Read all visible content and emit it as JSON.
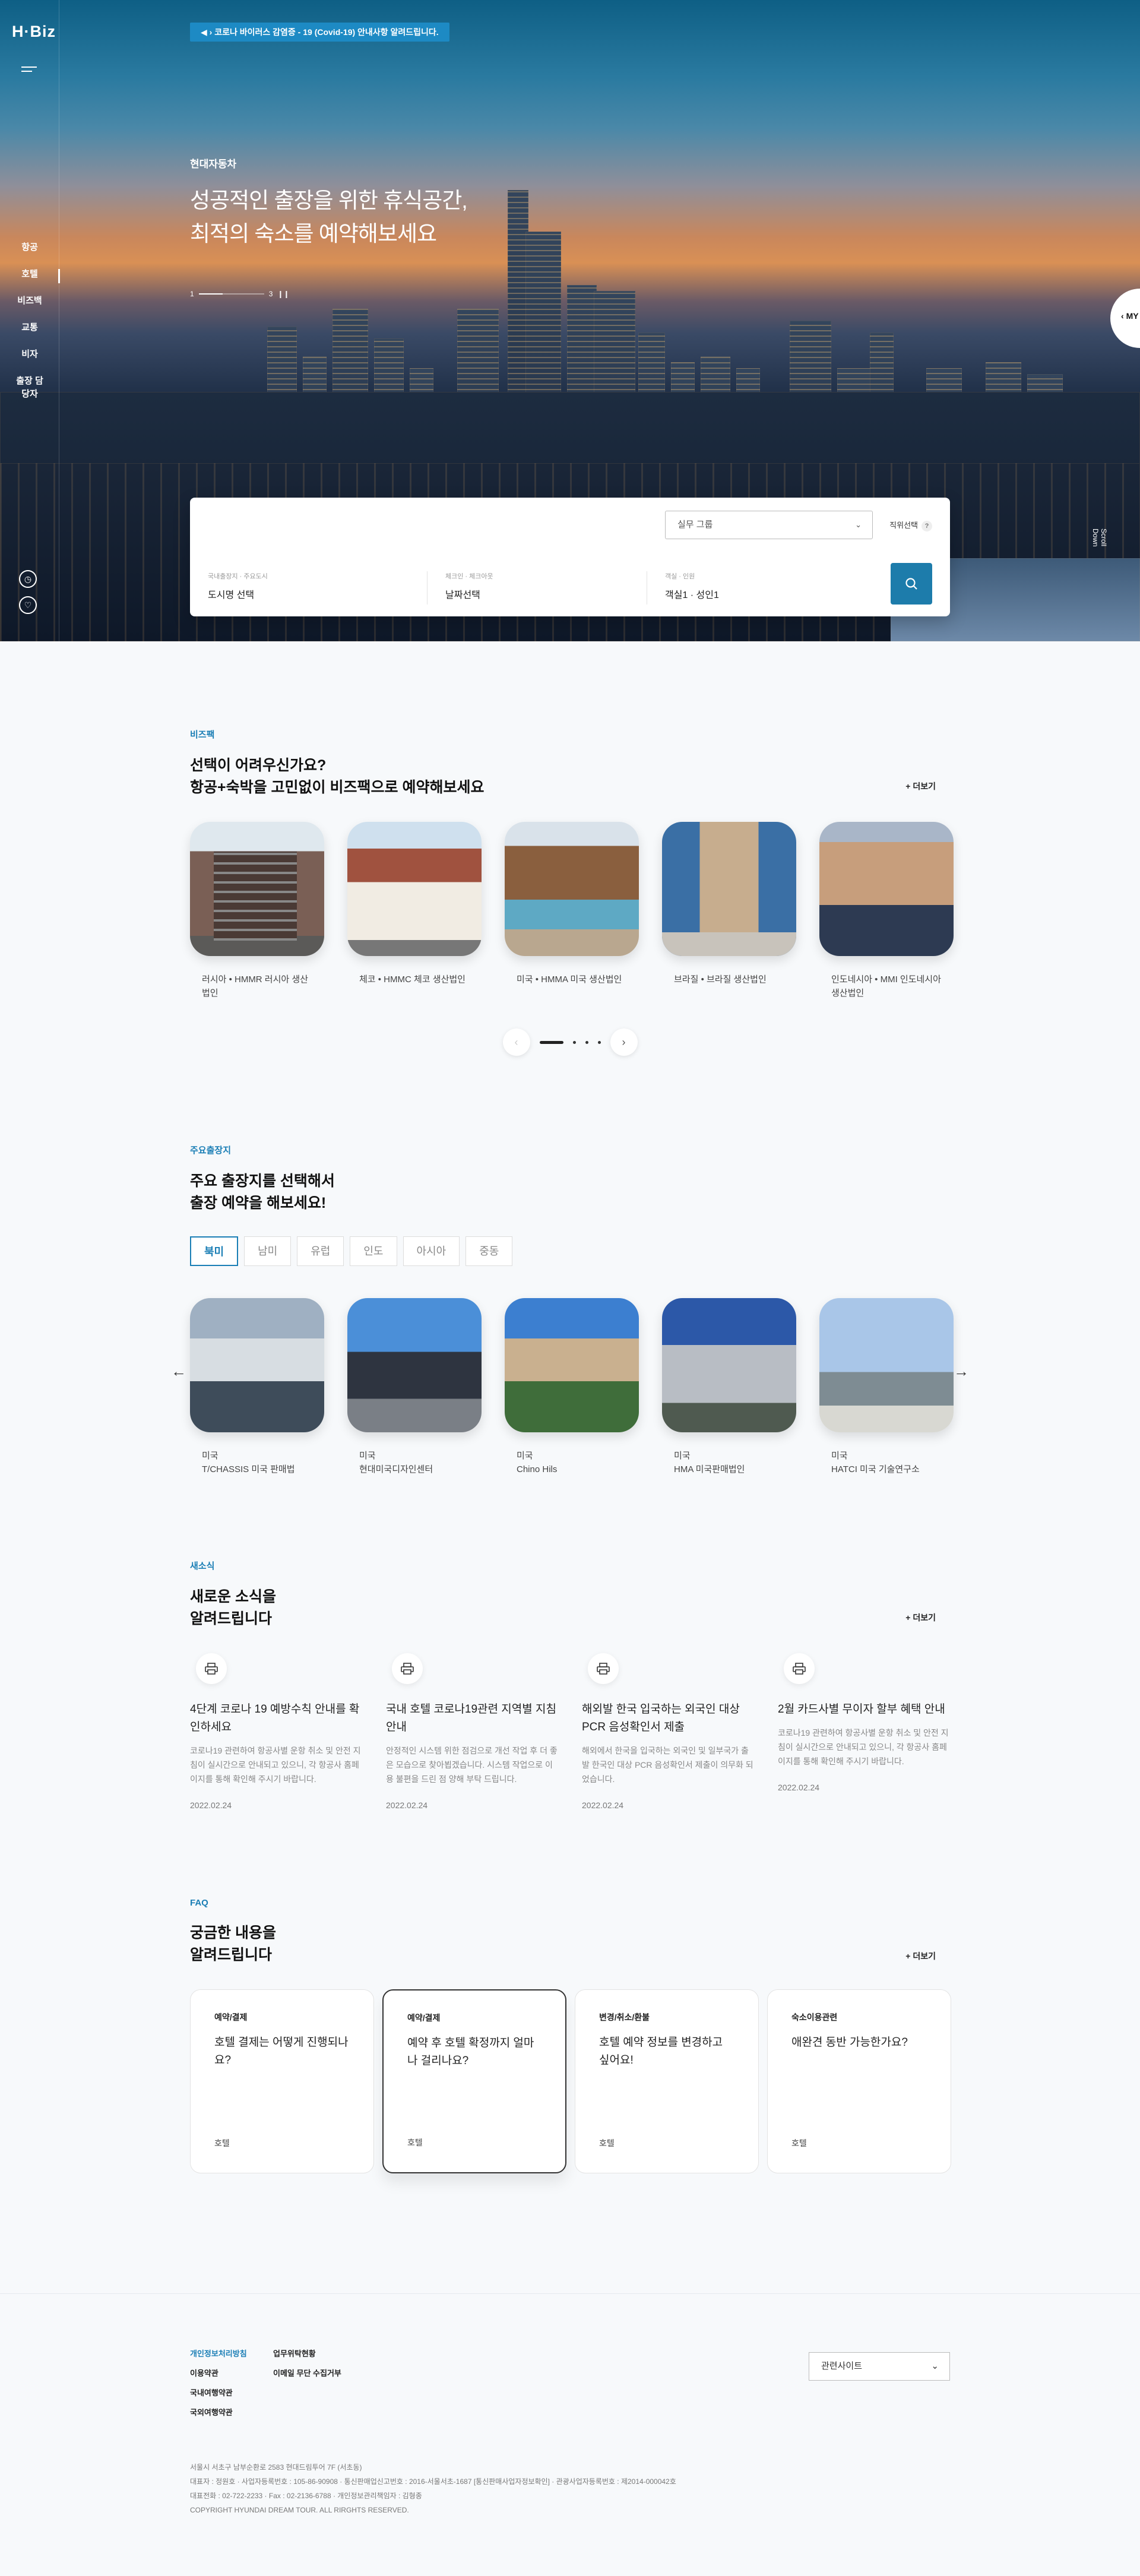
{
  "brand": "H·Biz",
  "notice": "코로나 바이러스 감염증 - 19 (Covid-19) 안내사항 알려드립니다.",
  "sidebar": {
    "items": [
      "항공",
      "호텔",
      "비즈백",
      "교통",
      "비자",
      "출장 담당자"
    ]
  },
  "hero": {
    "sub": "현대자동차",
    "title1": "성공적인 출장을 위한 휴식공간,",
    "title2": "최적의 숙소를 예약해보세요",
    "page_cur": "1",
    "page_total": "3",
    "my": "MY",
    "scroll": "Scroll Down"
  },
  "search": {
    "group": "실무 그룹",
    "position": "직위선택",
    "help": "?",
    "f1_label": "국내출장지 · 주요도시",
    "f1_value": "도시명 선택",
    "f2_label": "체크인 · 체크아웃",
    "f2_value": "날짜선택",
    "f3_label": "객실 · 인원",
    "f3_value": "객실1 · 성인1"
  },
  "bizpack": {
    "label": "비즈팩",
    "title1": "선택이 어려우신가요?",
    "title2": "항공+숙박을 고민없이 비즈팩으로 예약해보세요",
    "more": "+ 더보기",
    "items": [
      "러시아 • HMMR 러시아 생산법인",
      "체코 • HMMC 체코 생산법인",
      "미국 • HMMA 미국 생산법인",
      "브라질 • 브라질 생산법인",
      "인도네시아 • MMI 인도네시아 생산법인"
    ]
  },
  "dest": {
    "label": "주요출장지",
    "title1": "주요 출장지를 선택해서",
    "title2": "출장 예약을 해보세요!",
    "tabs": [
      "북미",
      "남미",
      "유럽",
      "인도",
      "아시아",
      "중동"
    ],
    "items": [
      {
        "c": "미국",
        "n": "T/CHASSIS 미국 판매법"
      },
      {
        "c": "미국",
        "n": "현대미국디자인센터"
      },
      {
        "c": "미국",
        "n": "Chino Hils"
      },
      {
        "c": "미국",
        "n": "HMA 미국판매법인"
      },
      {
        "c": "미국",
        "n": "HATCI 미국 기술연구소"
      }
    ]
  },
  "news": {
    "label": "새소식",
    "title1": "새로운 소식을",
    "title2": "알려드립니다",
    "more": "+ 더보기",
    "items": [
      {
        "t": "4단계 코로나 19 예방수칙 안내를 확인하세요",
        "d": "코로나19 관련하여 항공사별 운항 취소 및 안전 지침이 실시간으로 안내되고 있으니, 각 항공사 홈페이지를 통해 확인해 주시기 바랍니다.",
        "date": "2022.02.24"
      },
      {
        "t": "국내 호텔 코로나19관련 지역별 지침 안내",
        "d": "안정적인 시스템 위한 점검으로 개선 작업 후 더 좋은 모습으로 찾아뵙겠습니다. 시스템 작업으로 이용 불편을 드린 점 양해 부탁 드립니다.",
        "date": "2022.02.24"
      },
      {
        "t": "해외발 한국 입국하는 외국인 대상 PCR 음성확인서 제출",
        "d": "해외에서 한국을 입국하는 외국인 및 일부국가 출발 한국인 대상 PCR 음성확인서 제출이 의무화 되었습니다.",
        "date": "2022.02.24"
      },
      {
        "t": "2월 카드사별 무이자 할부 혜택 안내",
        "d": "코로나19 관련하여 항공사별 운항 취소 및 안전 지침이 실시간으로 안내되고 있으니, 각 항공사 홈페이지를 통해 확인해 주시기 바랍니다.",
        "date": "2022.02.24"
      }
    ]
  },
  "faq": {
    "label": "FAQ",
    "title1": "궁금한 내용을",
    "title2": "알려드립니다",
    "more": "+ 더보기",
    "items": [
      {
        "cat": "예약/결제",
        "q": "호텔 결제는 어떻게 진행되나요?",
        "tag": "호텔"
      },
      {
        "cat": "예약/결제",
        "q": "예약 후 호텔 확정까지 얼마나 걸리나요?",
        "tag": "호텔"
      },
      {
        "cat": "변경/취소/환불",
        "q": "호텔 예약 정보를 변경하고 싶어요!",
        "tag": "호텔"
      },
      {
        "cat": "숙소이용관련",
        "q": "애완견 동반 가능한가요?",
        "tag": "호텔"
      }
    ]
  },
  "footer": {
    "links": [
      "개인정보처리방침",
      "업무위탁현황",
      "이용약관",
      "이메일 무단 수집거부",
      "국내여행약관",
      "",
      "국외여행약관",
      ""
    ],
    "related": "관련사이트",
    "info1": "서울시 서초구 남부순환로 2583 현대드림투어 7F (서초동)",
    "info2": "대표자 : 정원호 · 사업자등록번호 : 105-86-90908 · 통신판매업신고번호 : 2016-서울서초-1687 [통신판매사업자정보확인] · 관광사업자등록번호 : 제2014-000042호",
    "info3": "대표전화 : 02-722-2233 · Fax : 02-2136-6788 · 개인정보관리책임자 : 김형종",
    "copy": "COPYRIGHT HYUNDAI DREAM TOUR. ALL RIRGHTS RESERVED."
  }
}
